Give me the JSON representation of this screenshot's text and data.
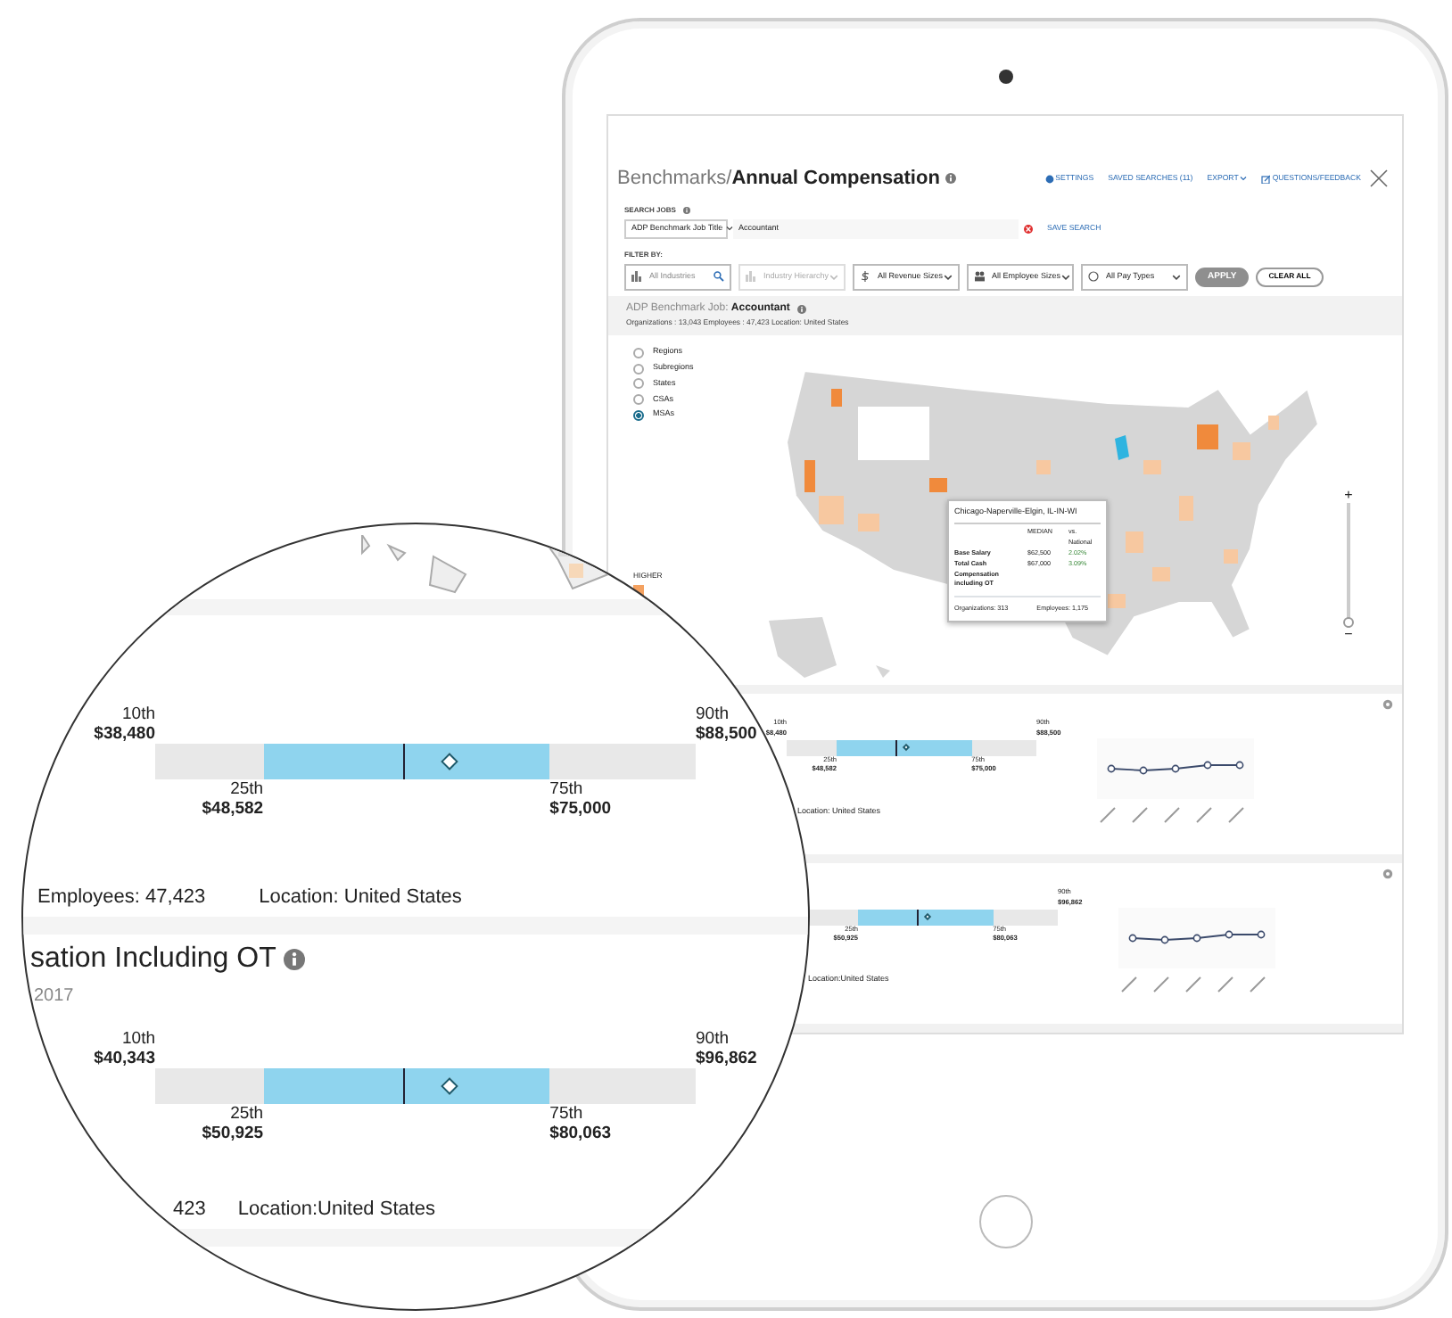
{
  "screen": {
    "title_prefix": "Benchmarks/",
    "title": "Annual Compensation",
    "header_links": [
      {
        "kind": "settings",
        "label": "SETTINGS"
      },
      {
        "kind": "plain",
        "label": "SAVED SEARCHES (11)"
      },
      {
        "kind": "dropdown",
        "label": "EXPORT"
      },
      {
        "kind": "feedback",
        "label": "QUESTIONS/FEEDBACK"
      }
    ],
    "search": {
      "label": "SEARCH JOBS",
      "type": "ADP Benchmark Job Title",
      "value": "Accountant",
      "save": "SAVE SEARCH"
    },
    "filters": {
      "label": "FILTER BY:",
      "fields": [
        {
          "kind": "industry",
          "placeholder": "All Industries",
          "disabled": false
        },
        {
          "kind": "hierarchy",
          "placeholder": "Industry Hierarchy",
          "disabled": true
        },
        {
          "kind": "revenue",
          "placeholder": "All Revenue Sizes",
          "disabled": false
        },
        {
          "kind": "employees",
          "placeholder": "All Employee Sizes",
          "disabled": false
        },
        {
          "kind": "pay",
          "placeholder": "All Pay Types",
          "disabled": false
        }
      ],
      "apply": {
        "label": "APPLY",
        "disabled": true
      },
      "clear": {
        "label": "CLEAR ALL"
      }
    },
    "job": {
      "label": "ADP Benchmark Job:",
      "name": "Accountant",
      "stats": "Organizations : 13,043   Employees : 47,423   Location: United States"
    },
    "geo_levels": [
      {
        "label": "Regions",
        "selected": false
      },
      {
        "label": "Subregions",
        "selected": false
      },
      {
        "label": "States",
        "selected": false
      },
      {
        "label": "CSAs",
        "selected": false
      },
      {
        "label": "MSAs",
        "selected": true
      }
    ],
    "legend": "HIGHER",
    "tooltip": {
      "title": "Chicago-Naperville-Elgin, IL-IN-WI",
      "col_1": "MEDIAN",
      "col_2": "vs. National",
      "rows": [
        {
          "label": "Base Salary",
          "median": "$62,500",
          "vs": "2.02%"
        },
        {
          "label": "Total Cash Compensation including OT",
          "median": "$67,000",
          "vs": "3.09%"
        }
      ],
      "organizations": "Organizations: 313",
      "employees": "Employees: 1,175"
    },
    "zoom": {
      "plus": "+",
      "minus": "−",
      "level": 0.05
    },
    "panels": [
      {
        "box": {
          "p10_label": "10th",
          "p10": "$8,480",
          "p90_label": "90th",
          "p90": "$88,500",
          "p25_label": "25th",
          "p25": "$48,582",
          "p75_label": "75th",
          "p75": "$75,000"
        },
        "location": "Location: United States"
      },
      {
        "box": {
          "p90_label": "90th",
          "p90": "$96,862",
          "p25_label": "25th",
          "p25": "$50,925",
          "p75_label": "75th",
          "p75": "$80,063"
        },
        "location": "Location:United States"
      }
    ]
  },
  "magnifier": {
    "panel_1": {
      "box": {
        "p10_label": "10th",
        "p10": "$38,480",
        "p90_label": "90th",
        "p90": "$88,500",
        "p25_label": "25th",
        "p25": "$48,582",
        "p75_label": "75th",
        "p75": "$75,000"
      },
      "meta": [
        "Employees: 47,423",
        "Location: United States"
      ]
    },
    "heading": {
      "title": "sation Including OT",
      "subtitle": "2017"
    },
    "panel_2": {
      "box": {
        "p10_label": "10th",
        "p10": "$40,343",
        "p90_label": "90th",
        "p90": "$96,862",
        "p25_label": "25th",
        "p25": "$50,925",
        "p75_label": "75th",
        "p75": "$80,063"
      },
      "meta": [
        "423",
        "Location:United States"
      ]
    }
  }
}
